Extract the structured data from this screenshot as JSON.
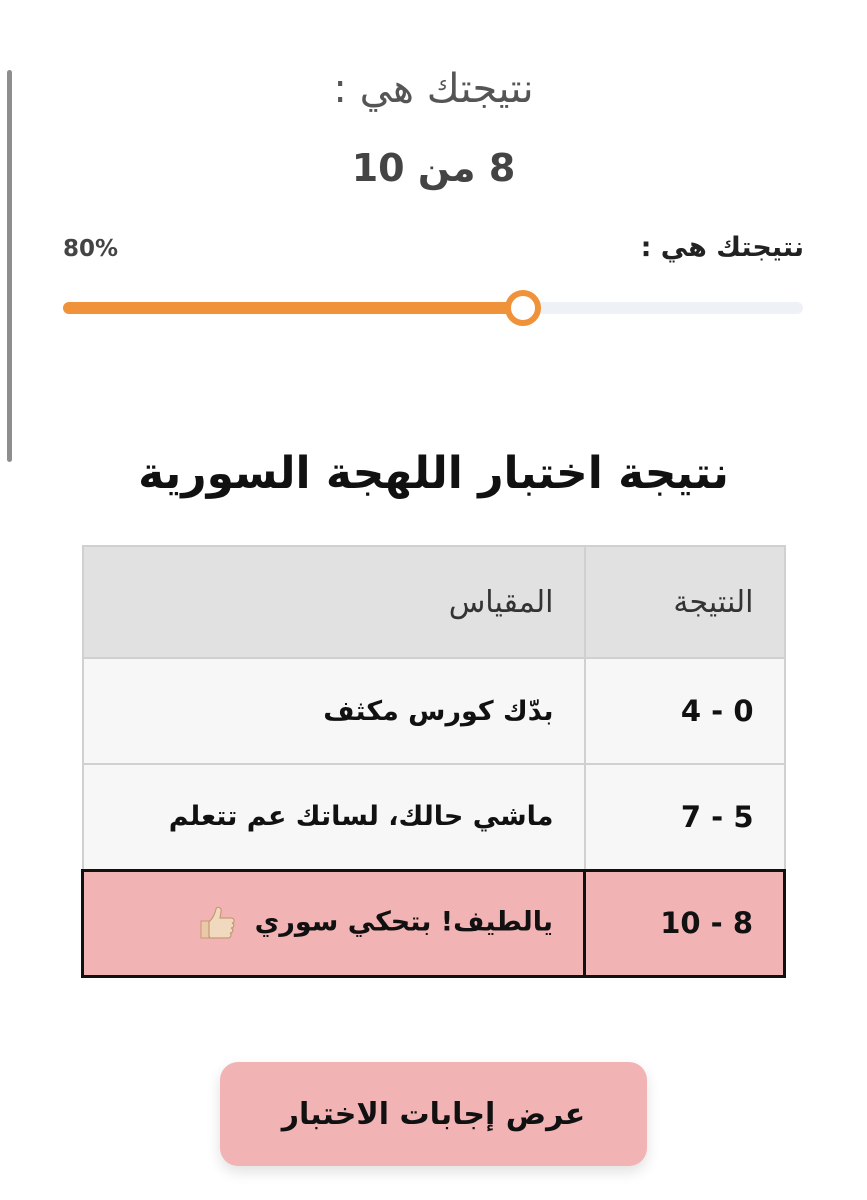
{
  "result": {
    "heading": "نتيجتك هي :",
    "score_text": "8 من 10"
  },
  "progress": {
    "label": "نتيجتك هي :",
    "percent_text": "80%",
    "value": 0.8,
    "color": "#ef923a"
  },
  "quiz": {
    "title": "نتيجة اختبار اللهجة السورية"
  },
  "table": {
    "headers": [
      "النتيجة",
      "المقياس"
    ],
    "rows": [
      {
        "score": "0 - 4",
        "scale": "بدّك كورس مكثف"
      },
      {
        "score": "5 - 7",
        "scale": "ماشي حالك، لساتك عم تتعلم"
      },
      {
        "score": "8 - 10",
        "scale": "يالطيف! بتحكي سوري",
        "icon": "thumbs-up-icon",
        "highlighted": true
      }
    ],
    "highlight_color": "#f2b3b4"
  },
  "actions": {
    "show_answers_label": "عرض إجابات الاختبار"
  }
}
